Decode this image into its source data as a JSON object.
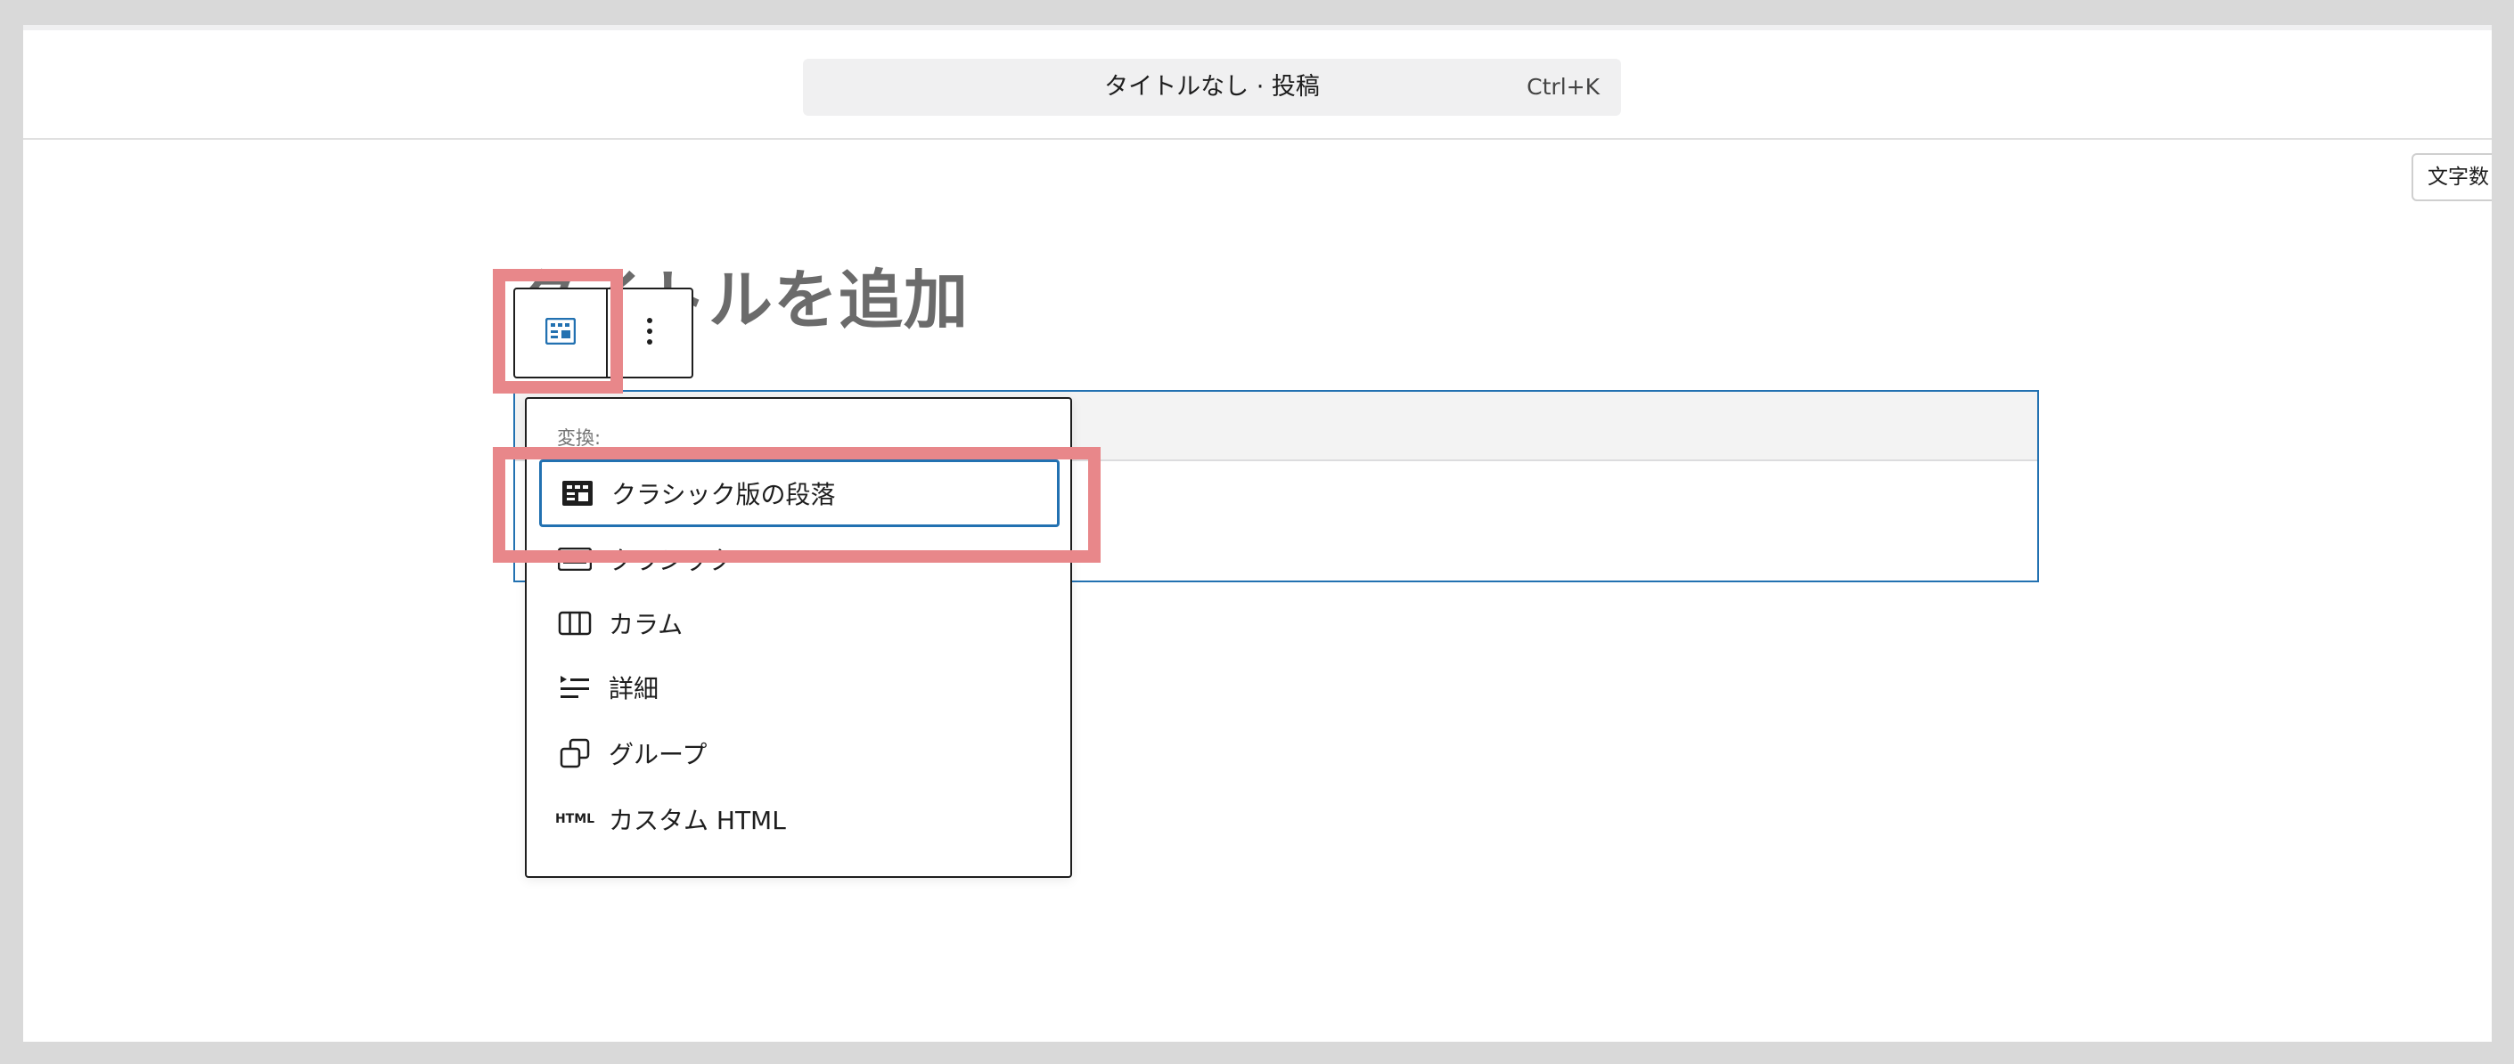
{
  "header": {
    "command_title": "タイトルなし · 投稿",
    "command_shortcut": "Ctrl+K",
    "word_count_label": "文字数"
  },
  "editor": {
    "title_placeholder": "タイトルを追加"
  },
  "block_toolbar": {
    "switcher_icon": "classic-block-icon",
    "options_icon": "more-vertical-icon"
  },
  "transform_menu": {
    "heading": "変換:",
    "items": [
      {
        "label": "クラシック版の段落",
        "icon": "classic-paragraph-icon",
        "focused": true
      },
      {
        "label": "クラシック",
        "icon": "keyboard-icon"
      },
      {
        "label": "カラム",
        "icon": "columns-icon"
      },
      {
        "label": "詳細",
        "icon": "details-icon"
      },
      {
        "label": "グループ",
        "icon": "group-icon"
      },
      {
        "label": "カスタム HTML",
        "icon": "html-icon",
        "icon_text": "HTML"
      }
    ]
  },
  "colors": {
    "accent": "#2271b1",
    "highlight": "#e8878a",
    "text": "#1e1e1e",
    "title_placeholder": "#6b6b6b"
  }
}
